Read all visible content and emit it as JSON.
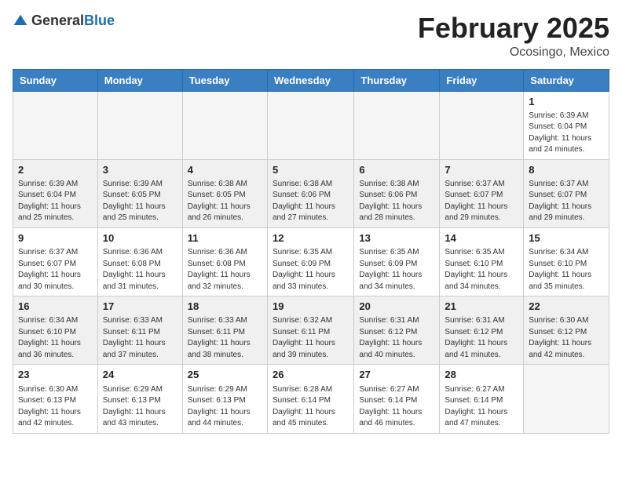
{
  "header": {
    "logo_general": "General",
    "logo_blue": "Blue",
    "month_title": "February 2025",
    "location": "Ocosingo, Mexico"
  },
  "days_of_week": [
    "Sunday",
    "Monday",
    "Tuesday",
    "Wednesday",
    "Thursday",
    "Friday",
    "Saturday"
  ],
  "weeks": [
    [
      {
        "day": "",
        "info": ""
      },
      {
        "day": "",
        "info": ""
      },
      {
        "day": "",
        "info": ""
      },
      {
        "day": "",
        "info": ""
      },
      {
        "day": "",
        "info": ""
      },
      {
        "day": "",
        "info": ""
      },
      {
        "day": "1",
        "info": "Sunrise: 6:39 AM\nSunset: 6:04 PM\nDaylight: 11 hours\nand 24 minutes."
      }
    ],
    [
      {
        "day": "2",
        "info": "Sunrise: 6:39 AM\nSunset: 6:04 PM\nDaylight: 11 hours\nand 25 minutes."
      },
      {
        "day": "3",
        "info": "Sunrise: 6:39 AM\nSunset: 6:05 PM\nDaylight: 11 hours\nand 25 minutes."
      },
      {
        "day": "4",
        "info": "Sunrise: 6:38 AM\nSunset: 6:05 PM\nDaylight: 11 hours\nand 26 minutes."
      },
      {
        "day": "5",
        "info": "Sunrise: 6:38 AM\nSunset: 6:06 PM\nDaylight: 11 hours\nand 27 minutes."
      },
      {
        "day": "6",
        "info": "Sunrise: 6:38 AM\nSunset: 6:06 PM\nDaylight: 11 hours\nand 28 minutes."
      },
      {
        "day": "7",
        "info": "Sunrise: 6:37 AM\nSunset: 6:07 PM\nDaylight: 11 hours\nand 29 minutes."
      },
      {
        "day": "8",
        "info": "Sunrise: 6:37 AM\nSunset: 6:07 PM\nDaylight: 11 hours\nand 29 minutes."
      }
    ],
    [
      {
        "day": "9",
        "info": "Sunrise: 6:37 AM\nSunset: 6:07 PM\nDaylight: 11 hours\nand 30 minutes."
      },
      {
        "day": "10",
        "info": "Sunrise: 6:36 AM\nSunset: 6:08 PM\nDaylight: 11 hours\nand 31 minutes."
      },
      {
        "day": "11",
        "info": "Sunrise: 6:36 AM\nSunset: 6:08 PM\nDaylight: 11 hours\nand 32 minutes."
      },
      {
        "day": "12",
        "info": "Sunrise: 6:35 AM\nSunset: 6:09 PM\nDaylight: 11 hours\nand 33 minutes."
      },
      {
        "day": "13",
        "info": "Sunrise: 6:35 AM\nSunset: 6:09 PM\nDaylight: 11 hours\nand 34 minutes."
      },
      {
        "day": "14",
        "info": "Sunrise: 6:35 AM\nSunset: 6:10 PM\nDaylight: 11 hours\nand 34 minutes."
      },
      {
        "day": "15",
        "info": "Sunrise: 6:34 AM\nSunset: 6:10 PM\nDaylight: 11 hours\nand 35 minutes."
      }
    ],
    [
      {
        "day": "16",
        "info": "Sunrise: 6:34 AM\nSunset: 6:10 PM\nDaylight: 11 hours\nand 36 minutes."
      },
      {
        "day": "17",
        "info": "Sunrise: 6:33 AM\nSunset: 6:11 PM\nDaylight: 11 hours\nand 37 minutes."
      },
      {
        "day": "18",
        "info": "Sunrise: 6:33 AM\nSunset: 6:11 PM\nDaylight: 11 hours\nand 38 minutes."
      },
      {
        "day": "19",
        "info": "Sunrise: 6:32 AM\nSunset: 6:11 PM\nDaylight: 11 hours\nand 39 minutes."
      },
      {
        "day": "20",
        "info": "Sunrise: 6:31 AM\nSunset: 6:12 PM\nDaylight: 11 hours\nand 40 minutes."
      },
      {
        "day": "21",
        "info": "Sunrise: 6:31 AM\nSunset: 6:12 PM\nDaylight: 11 hours\nand 41 minutes."
      },
      {
        "day": "22",
        "info": "Sunrise: 6:30 AM\nSunset: 6:12 PM\nDaylight: 11 hours\nand 42 minutes."
      }
    ],
    [
      {
        "day": "23",
        "info": "Sunrise: 6:30 AM\nSunset: 6:13 PM\nDaylight: 11 hours\nand 42 minutes."
      },
      {
        "day": "24",
        "info": "Sunrise: 6:29 AM\nSunset: 6:13 PM\nDaylight: 11 hours\nand 43 minutes."
      },
      {
        "day": "25",
        "info": "Sunrise: 6:29 AM\nSunset: 6:13 PM\nDaylight: 11 hours\nand 44 minutes."
      },
      {
        "day": "26",
        "info": "Sunrise: 6:28 AM\nSunset: 6:14 PM\nDaylight: 11 hours\nand 45 minutes."
      },
      {
        "day": "27",
        "info": "Sunrise: 6:27 AM\nSunset: 6:14 PM\nDaylight: 11 hours\nand 46 minutes."
      },
      {
        "day": "28",
        "info": "Sunrise: 6:27 AM\nSunset: 6:14 PM\nDaylight: 11 hours\nand 47 minutes."
      },
      {
        "day": "",
        "info": ""
      }
    ]
  ]
}
